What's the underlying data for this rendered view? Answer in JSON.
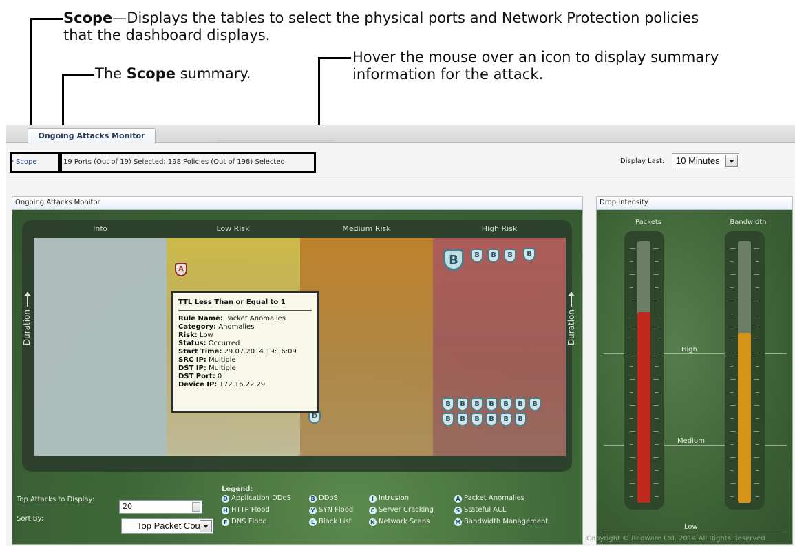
{
  "callouts": {
    "scope": {
      "term": "Scope",
      "text_line1": "—Displays the tables to select the physical ports and Network Protection policies",
      "text_line2": "that the dashboard displays."
    },
    "summary": {
      "prefix": "The ",
      "term": "Scope",
      "suffix": " summary."
    },
    "hover": {
      "line1": "Hover the mouse over an icon to display summary",
      "line2": "information for the attack."
    }
  },
  "tab": {
    "label": "Ongoing Attacks Monitor"
  },
  "scope_bar": {
    "scope_label": "Scope",
    "summary": "19 Ports (Out of 19) Selected; 198 Policies (Out of 198) Selected",
    "display_last_label": "Display Last:",
    "display_last_value": "10 Minutes"
  },
  "monitor": {
    "title": "Ongoing Attacks Monitor",
    "columns": [
      "Info",
      "Low Risk",
      "Medium Risk",
      "High Risk"
    ],
    "axis_label": "Duration",
    "icons": {
      "low": "A",
      "medium": "D",
      "high_top_big": "B",
      "high_top": [
        "B",
        "B",
        "B",
        "B"
      ],
      "high_bottom_row1": [
        "B",
        "B",
        "B",
        "B",
        "B",
        "B",
        "B"
      ],
      "high_bottom_row2": [
        "B",
        "B",
        "B",
        "B",
        "B",
        "B"
      ]
    },
    "tooltip": {
      "title": "TTL Less Than or Equal to 1",
      "rule_name_label": "Rule Name:",
      "rule_name": "Packet Anomalies",
      "category_label": "Category:",
      "category": "Anomalies",
      "risk_label": "Risk:",
      "risk": "Low",
      "status_label": "Status:",
      "status": "Occurred",
      "start_time_label": "Start Time:",
      "start_time": "29.07.2014 19:16:09",
      "src_ip_label": "SRC IP:",
      "src_ip": "Multiple",
      "dst_ip_label": "DST IP:",
      "dst_ip": "Multiple",
      "dst_port_label": "DST Port:",
      "dst_port": "0",
      "device_ip_label": "Device IP:",
      "device_ip": "172.16.22.29"
    },
    "top_attacks_label": "Top Attacks to Display:",
    "top_attacks_value": "20",
    "sort_by_label": "Sort By:",
    "sort_by_value": "Top Packet Count",
    "legend": {
      "title": "Legend:",
      "items": [
        {
          "badge": "D",
          "label": "Application DDoS"
        },
        {
          "badge": "H",
          "label": "HTTP Flood"
        },
        {
          "badge": "F",
          "label": "DNS Flood"
        },
        {
          "badge": "B",
          "label": "DDoS"
        },
        {
          "badge": "Y",
          "label": "SYN Flood"
        },
        {
          "badge": "L",
          "label": "Black List"
        },
        {
          "badge": "I",
          "label": "Intrusion"
        },
        {
          "badge": "C",
          "label": "Server Cracking"
        },
        {
          "badge": "N",
          "label": "Network Scans"
        },
        {
          "badge": "A",
          "label": "Packet Anomalies"
        },
        {
          "badge": "S",
          "label": "Stateful ACL"
        },
        {
          "badge": "M",
          "label": "Bandwidth Management"
        }
      ]
    }
  },
  "drop_intensity": {
    "title": "Drop Intensity",
    "packets_label": "Packets",
    "bandwidth_label": "Bandwidth",
    "levels": {
      "high": "High",
      "medium": "Medium",
      "low": "Low"
    },
    "packets_level": 0.73,
    "bandwidth_level": 0.65,
    "packets_color": "#c0281e",
    "bandwidth_color": "#d9941a",
    "copyright": "Copyright © Radware Ltd. 2014 All Rights Reserved"
  }
}
